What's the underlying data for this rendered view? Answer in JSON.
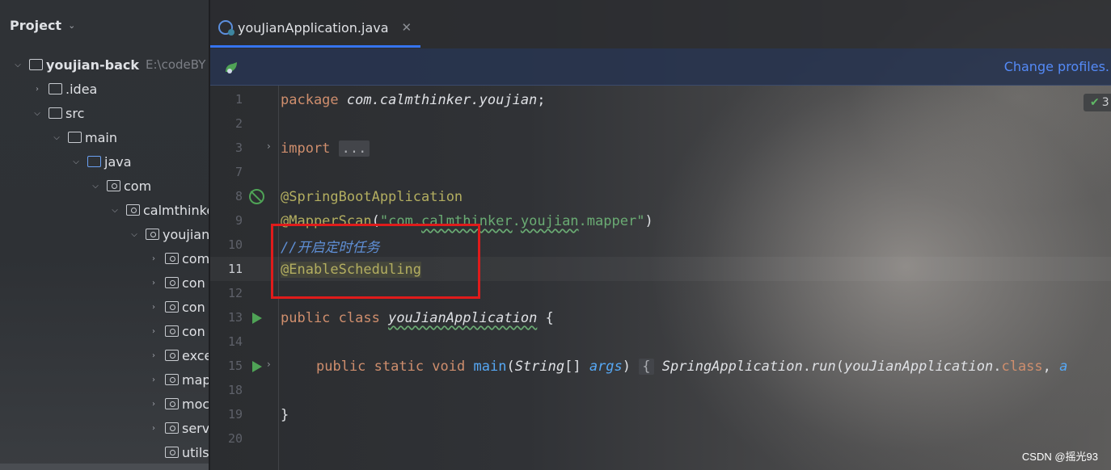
{
  "project": {
    "title": "Project",
    "tree": [
      {
        "label": "youjian-back",
        "path": "E:\\codeBY"
      },
      {
        "label": ".idea"
      },
      {
        "label": "src"
      },
      {
        "label": "main"
      },
      {
        "label": "java"
      },
      {
        "label": "com"
      },
      {
        "label": "calmthinke"
      },
      {
        "label": "youjian"
      },
      {
        "label": "com"
      },
      {
        "label": "con"
      },
      {
        "label": "con"
      },
      {
        "label": "con"
      },
      {
        "label": "exce"
      },
      {
        "label": "map"
      },
      {
        "label": "moc"
      },
      {
        "label": "serv"
      },
      {
        "label": "utils"
      }
    ]
  },
  "editor": {
    "tab_label": "youJianApplication.java",
    "profile_link": "Change profiles.",
    "inspection_count": "3",
    "line_numbers": [
      "1",
      "2",
      "3",
      "7",
      "8",
      "9",
      "10",
      "11",
      "12",
      "13",
      "14",
      "15",
      "18",
      "19",
      "20"
    ],
    "code": {
      "l1_kw": "package",
      "l1_pkg": " com.calmthinker.youjian",
      "l1_end": ";",
      "l3_kw": "import",
      "l3_fold": "...",
      "l8_ann": "@SpringBootApplication",
      "l9_ann": "@MapperScan",
      "l9_open": "(",
      "l9_str_q1": "\"",
      "l9_str_a": "com.",
      "l9_str_b": "calmthinker",
      "l9_str_c": ".",
      "l9_str_d": "youjian",
      "l9_str_e": ".mapper\"",
      "l9_close": ")",
      "l10_cmt": "//开启定时任务",
      "l11_ann": "@EnableScheduling",
      "l13_kw": "public class",
      "l13_name": "youJianApplication",
      "l13_brace": " {",
      "l15_kw": "public static void",
      "l15_main": "main",
      "l15_open": "(",
      "l15_type": "String",
      "l15_arr": "[] ",
      "l15_param": "args",
      "l15_close": ") ",
      "l15_fold": "{",
      "l15_cls": "SpringApplication",
      "l15_dot": ".",
      "l15_run": "run",
      "l15_open2": "(",
      "l15_app": "youJianApplication",
      "l15_dot2": ".",
      "l15_classkw": "class",
      "l15_comma": ", ",
      "l15_trunc": "a",
      "l19_brace": "}"
    }
  },
  "watermark": "CSDN @摇光93"
}
